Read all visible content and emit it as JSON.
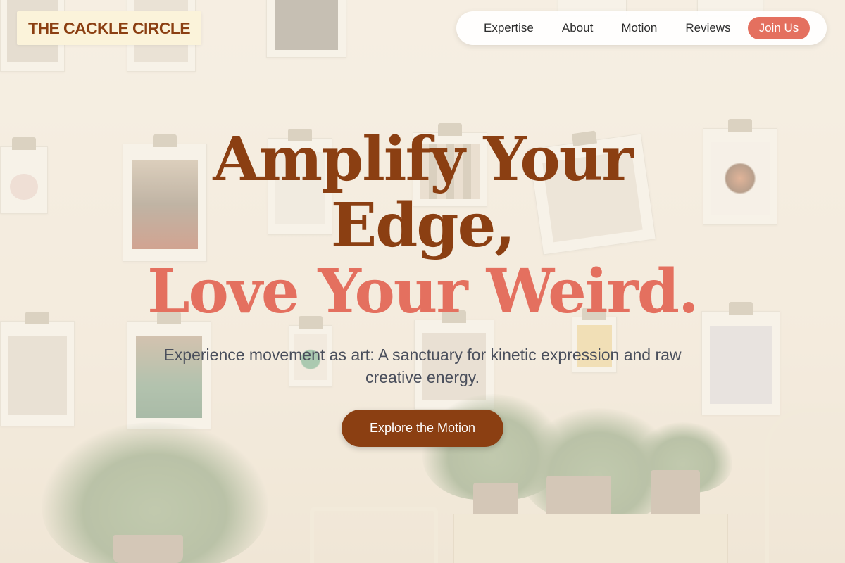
{
  "brand": {
    "name": "THE CACKLE CIRCLE"
  },
  "nav": {
    "items": [
      {
        "label": "Expertise"
      },
      {
        "label": "About"
      },
      {
        "label": "Motion"
      },
      {
        "label": "Reviews"
      }
    ],
    "cta_label": "Join Us"
  },
  "hero": {
    "headline_line1": "Amplify Your",
    "headline_line2": "Edge,",
    "headline_line3": "Love Your Weird.",
    "subtitle": "Experience movement as art: A sanctuary for kinetic expression and raw creative energy.",
    "cta_label": "Explore the Motion"
  },
  "colors": {
    "brand_brown": "#8b3f12",
    "accent_coral": "#e4705f",
    "brand_bg": "#fbf3da",
    "subtitle_gray": "#4a4f5c"
  },
  "icons": []
}
